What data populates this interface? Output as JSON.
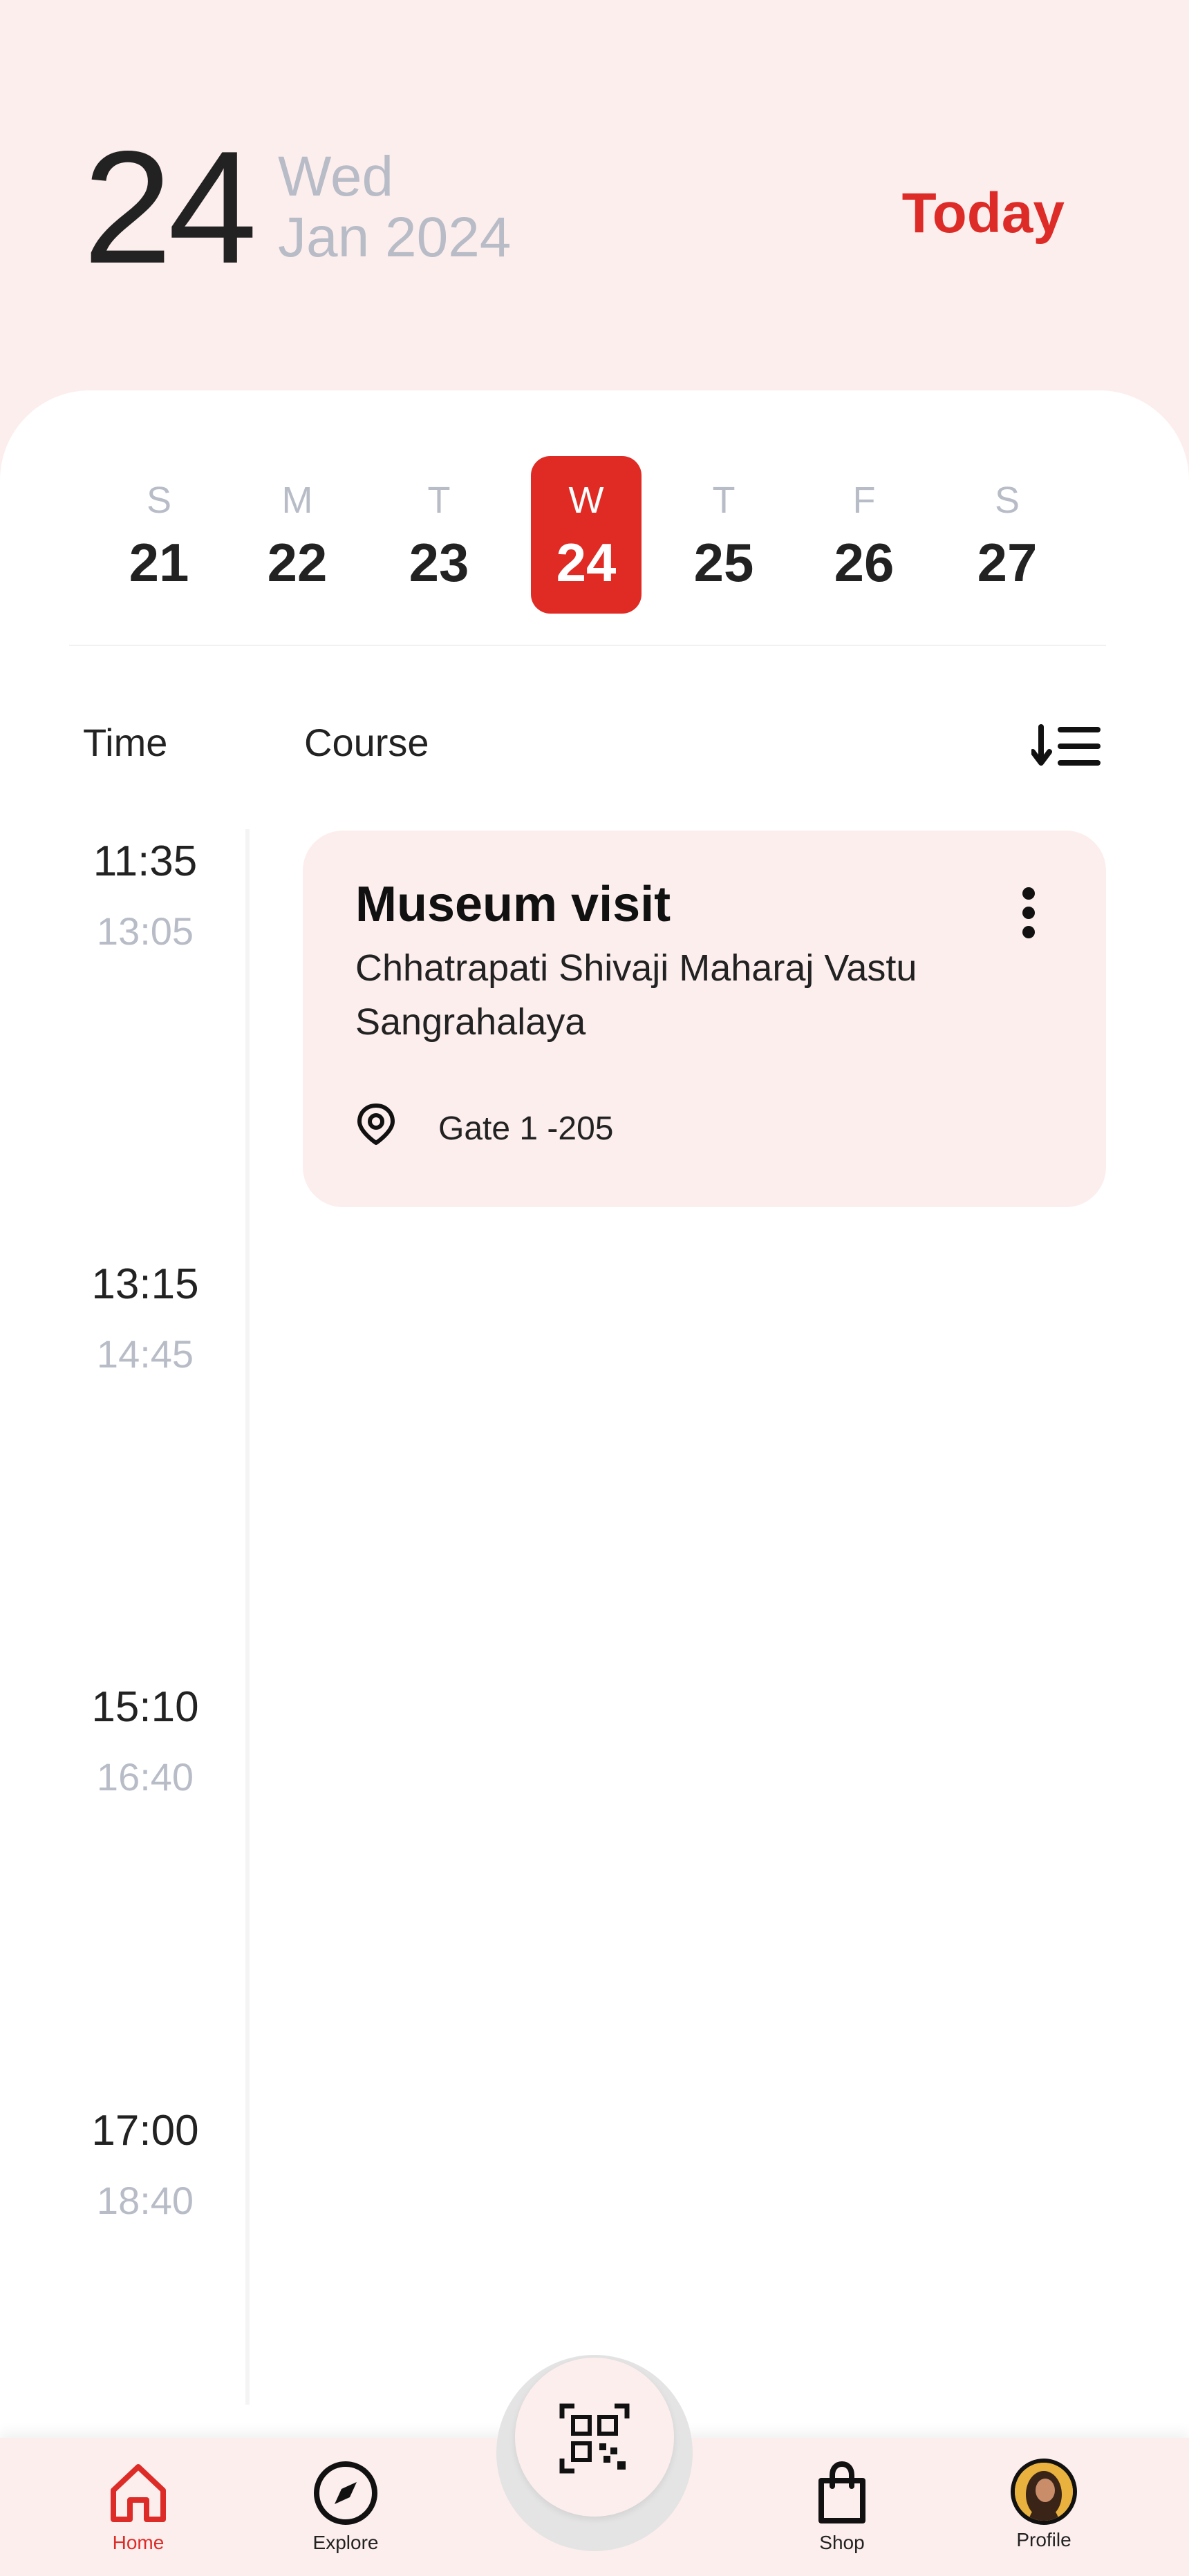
{
  "header": {
    "day_number": "24",
    "weekday": "Wed",
    "month_year": "Jan 2024",
    "today_label": "Today"
  },
  "week": {
    "days": [
      {
        "letter": "S",
        "num": "21"
      },
      {
        "letter": "M",
        "num": "22"
      },
      {
        "letter": "T",
        "num": "23"
      },
      {
        "letter": "W",
        "num": "24"
      },
      {
        "letter": "T",
        "num": "25"
      },
      {
        "letter": "F",
        "num": "26"
      },
      {
        "letter": "S",
        "num": "27"
      }
    ]
  },
  "columns": {
    "time": "Time",
    "course": "Course"
  },
  "slots": [
    {
      "start": "11:35",
      "end": "13:05"
    },
    {
      "start": "13:15",
      "end": "14:45"
    },
    {
      "start": "15:10",
      "end": "16:40"
    },
    {
      "start": "17:00",
      "end": "18:40"
    }
  ],
  "event": {
    "title": "Museum visit",
    "subtitle": "Chhatrapati Shivaji Maharaj Vastu Sangrahalaya",
    "location": "Gate 1 -205"
  },
  "nav": {
    "items": [
      {
        "label": "Home",
        "icon": "home-icon"
      },
      {
        "label": "Explore",
        "icon": "compass-icon"
      },
      {
        "label": "Shop",
        "icon": "shopping-bag-icon"
      },
      {
        "label": "Profile",
        "icon": "avatar"
      }
    ]
  },
  "colors": {
    "accent": "#dd2c27",
    "background_tint": "#fdeeee",
    "muted_text": "#b8bcc7"
  }
}
